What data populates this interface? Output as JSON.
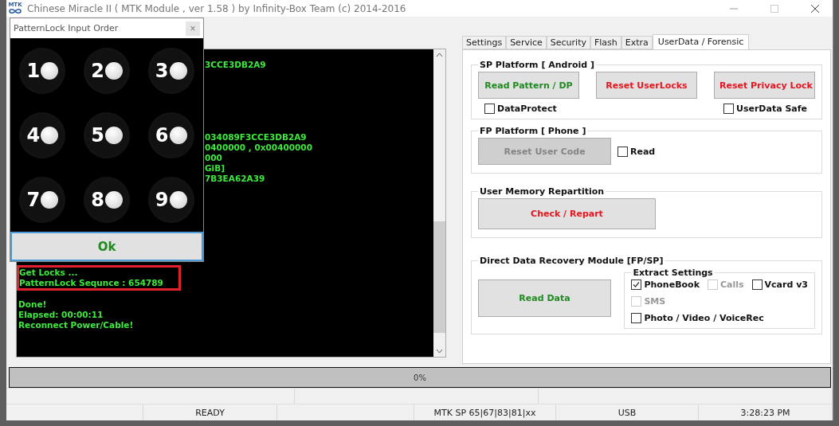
{
  "window": {
    "title": "Chinese Miracle II ( MTK Module , ver 1.58 ) by Infinity-Box Team (c) 2014-2016",
    "logo": "MTK"
  },
  "log": [
    {
      "kind": "covered",
      "text": "3CCE3DB2A9"
    },
    {
      "kind": "blank"
    },
    {
      "kind": "blank"
    },
    {
      "kind": "blank"
    },
    {
      "kind": "blank"
    },
    {
      "kind": "blank"
    },
    {
      "kind": "blank"
    },
    {
      "kind": "covered",
      "text": "034089F3CCE3DB2A9"
    },
    {
      "kind": "covered",
      "text": "0400000 , 0x00400000"
    },
    {
      "kind": "covered",
      "text": "000"
    },
    {
      "kind": "covered",
      "text": "GiB]"
    },
    {
      "kind": "covered",
      "text": "7B3EA62A39"
    },
    {
      "kind": "blank"
    },
    {
      "kind": "blank"
    },
    {
      "kind": "blank"
    },
    {
      "kind": "blank"
    },
    {
      "kind": "blank"
    },
    {
      "kind": "blank"
    },
    {
      "kind": "blank"
    },
    {
      "kind": "blank"
    },
    {
      "kind": "boxed",
      "lines": [
        "Get Locks ...",
        "PatternLock Sequnce : 654789"
      ]
    },
    {
      "kind": "blank"
    },
    {
      "kind": "line",
      "text": "Done!"
    },
    {
      "kind": "line",
      "text": "Elapsed: 00:00:11"
    },
    {
      "kind": "line",
      "text": "Reconnect Power/Cable!"
    }
  ],
  "dialog": {
    "title": "PatternLock Input Order",
    "close": "×",
    "dots": [
      "1",
      "2",
      "3",
      "4",
      "5",
      "6",
      "7",
      "8",
      "9"
    ],
    "ok": "Ok"
  },
  "tabs": [
    {
      "label": "Settings",
      "selected": false
    },
    {
      "label": "Service",
      "selected": false
    },
    {
      "label": "Security",
      "selected": false
    },
    {
      "label": "Flash",
      "selected": false
    },
    {
      "label": "Extra",
      "selected": false
    },
    {
      "label": "UserData / Forensic",
      "selected": true
    }
  ],
  "sp_platform": {
    "title": "SP Platform [ Android ]",
    "buttons": [
      {
        "label": "Read Pattern / DP",
        "color": "#1f8a1f"
      },
      {
        "label": "Reset UserLocks",
        "color": "#e8141e"
      },
      {
        "label": "Reset Privacy Lock",
        "color": "#e8141e"
      }
    ],
    "checkboxes": [
      {
        "label": "DataProtect",
        "checked": false
      },
      {
        "label": "UserData Safe",
        "checked": false
      }
    ]
  },
  "fp_platform": {
    "title": "FP Platform [ Phone ]",
    "button": {
      "label": "Reset User Code",
      "disabled": true
    },
    "checkbox": {
      "label": "Read",
      "checked": false
    }
  },
  "repartition": {
    "title": "User Memory Repartition",
    "button": {
      "label": "Check / Repart",
      "color": "#e8141e"
    }
  },
  "recovery": {
    "title": "Direct Data Recovery Module  [FP/SP]",
    "button": {
      "label": "Read Data",
      "color": "#1f8a1f"
    },
    "extract": {
      "title": "Extract Settings",
      "options": [
        {
          "label": "PhoneBook",
          "checked": true,
          "disabled": false
        },
        {
          "label": "Calls",
          "checked": false,
          "disabled": true
        },
        {
          "label": "Vcard v3",
          "checked": false,
          "disabled": false
        },
        {
          "label": "SMS",
          "checked": false,
          "disabled": true
        },
        {
          "label": "Photo / Video / VoiceRec",
          "checked": false,
          "disabled": false
        }
      ]
    }
  },
  "progress": {
    "level": 0,
    "reading": "0%"
  },
  "status_bar": [
    "READY",
    "MTK SP 65|67|83|81|xx",
    "USB",
    "3:28:23 PM"
  ]
}
